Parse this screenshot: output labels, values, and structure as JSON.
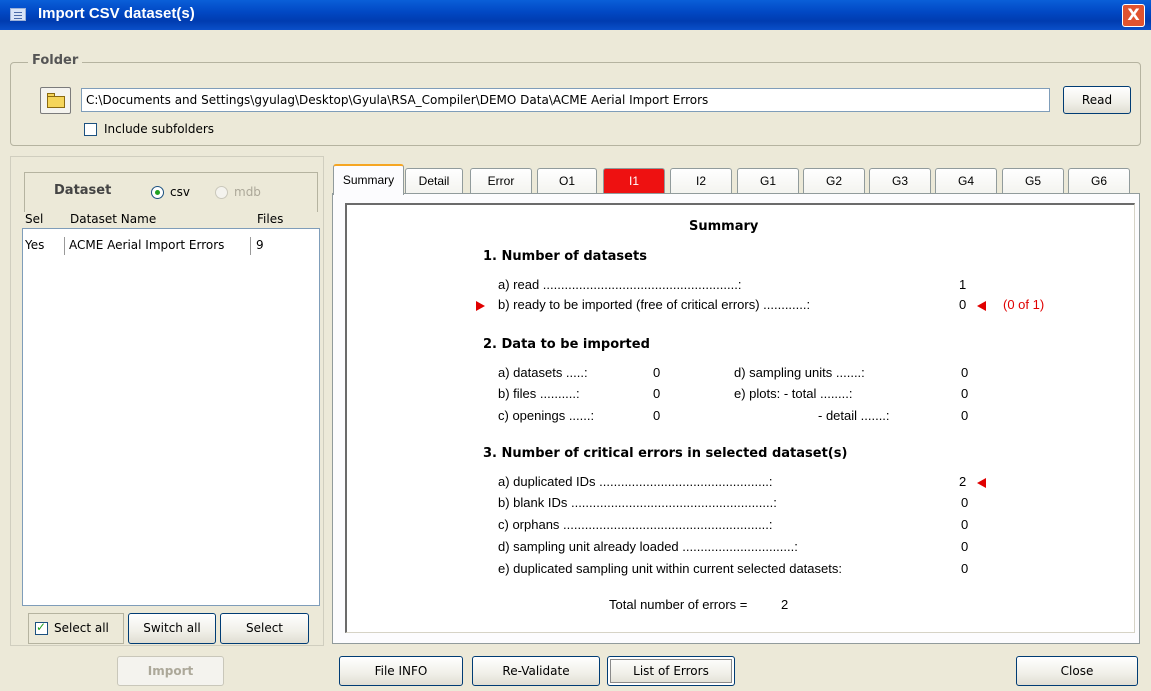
{
  "window": {
    "title": "Import CSV dataset(s)",
    "close_label": "X"
  },
  "folder": {
    "legend": "Folder",
    "path": "C:\\Documents and Settings\\gyulag\\Desktop\\Gyula\\RSA_Compiler\\DEMO Data\\ACME Aerial Import Errors",
    "read_label": "Read",
    "include_subfolders_label": "Include subfolders",
    "include_subfolders_checked": false
  },
  "dataset": {
    "legend": "Dataset",
    "radio_csv": "csv",
    "radio_mdb": "mdb",
    "selected_format": "csv",
    "columns": [
      "Sel",
      "Dataset Name",
      "Files"
    ],
    "rows": [
      {
        "sel": "Yes",
        "name": "ACME Aerial Import Errors",
        "files": "9"
      }
    ],
    "select_all_label": "Select all",
    "select_all_checked": true,
    "switch_all_label": "Switch all",
    "select_label": "Select",
    "import_label": "Import"
  },
  "tabs": [
    "Summary",
    "Detail",
    "Error",
    "O1",
    "I1",
    "I2",
    "G1",
    "G2",
    "G3",
    "G4",
    "G5",
    "G6"
  ],
  "active_tab": "Summary",
  "error_tab": "I1",
  "summary": {
    "title": "Summary",
    "s1": {
      "heading": "1. Number of datasets",
      "a_label": "a) read  ......................................................:",
      "a_value": "1",
      "b_label": "b) ready to be imported (free of critical errors)  ............:",
      "b_value": "0",
      "b_note": "(0 of 1)"
    },
    "s2": {
      "heading": "2. Data to be imported",
      "a_label": "a) datasets  .....:",
      "a_value": "0",
      "b_label": "b) files  ..........:",
      "b_value": "0",
      "c_label": "c) openings  ......:",
      "c_value": "0",
      "d_label": "d) sampling units  .......:",
      "d_value": "0",
      "e_label": "e) plots:  - total  ........:",
      "e_value": "0",
      "f_label": "- detail  .......:",
      "f_value": "0"
    },
    "s3": {
      "heading": "3. Number of critical errors in selected dataset(s)",
      "items": [
        {
          "label": "a) duplicated IDs  ...............................................:",
          "value": "2"
        },
        {
          "label": "b) blank IDs  ........................................................:",
          "value": "0"
        },
        {
          "label": "c) orphans  .........................................................:",
          "value": "0"
        },
        {
          "label": "d) sampling unit already loaded  ...............................:",
          "value": "0"
        },
        {
          "label": "e) duplicated sampling unit within current selected datasets:",
          "value": "0"
        }
      ],
      "total_label": "Total number of errors =",
      "total_value": "2"
    }
  },
  "buttons": {
    "file_info": "File INFO",
    "revalidate": "Re-Validate",
    "list_errors": "List of Errors",
    "close": "Close"
  },
  "colors": {
    "error_red": "#e00000",
    "title_blue": "#0148c4",
    "active_tab_accent": "#f5a623"
  }
}
